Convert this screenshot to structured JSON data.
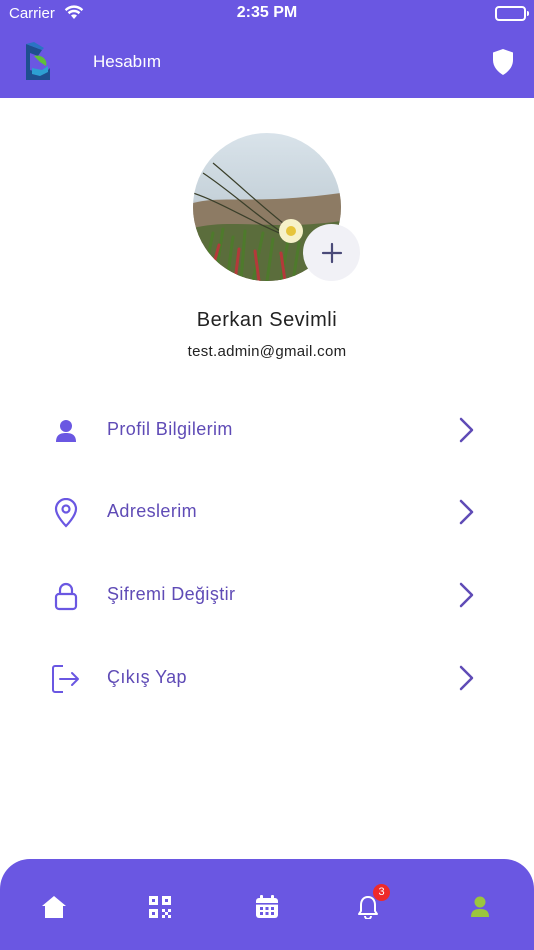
{
  "status_bar": {
    "carrier": "Carrier",
    "time": "2:35 PM"
  },
  "header": {
    "title": "Hesabım"
  },
  "profile": {
    "name": "Berkan Sevimli",
    "email": "test.admin@gmail.com"
  },
  "menu": [
    {
      "label": "Profil Bilgilerim",
      "icon": "user-icon"
    },
    {
      "label": "Adreslerim",
      "icon": "location-pin-icon"
    },
    {
      "label": "Şifremi Değiştir",
      "icon": "lock-icon"
    },
    {
      "label": "Çıkış Yap",
      "icon": "logout-icon"
    }
  ],
  "bottom_nav": {
    "items": [
      "home-icon",
      "qr-code-icon",
      "calendar-icon",
      "bell-icon",
      "user-icon"
    ],
    "notification_count": "3",
    "active": "user-icon"
  },
  "colors": {
    "primary": "#6a57e2",
    "menu_text": "#5f4bb6",
    "active_nav": "#9bc53d",
    "badge": "#ee2a2a"
  }
}
